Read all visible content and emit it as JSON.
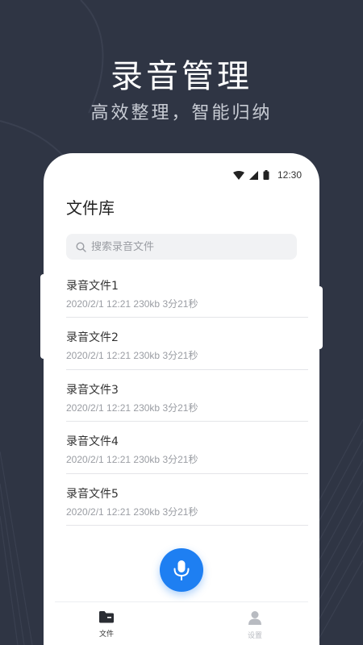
{
  "promo": {
    "title": "录音管理",
    "subtitle": "高效整理，智能归纳"
  },
  "status_bar": {
    "time": "12:30",
    "icons": [
      "wifi-icon",
      "cellular-signal-icon",
      "battery-icon"
    ]
  },
  "page": {
    "title": "文件库"
  },
  "search": {
    "placeholder": "搜索录音文件"
  },
  "files": [
    {
      "name": "录音文件1",
      "meta": "2020/2/1 12:21 230kb 3分21秒"
    },
    {
      "name": "录音文件2",
      "meta": "2020/2/1 12:21 230kb 3分21秒"
    },
    {
      "name": "录音文件3",
      "meta": "2020/2/1 12:21 230kb 3分21秒"
    },
    {
      "name": "录音文件4",
      "meta": "2020/2/1 12:21 230kb 3分21秒"
    },
    {
      "name": "录音文件5",
      "meta": "2020/2/1 12:21 230kb 3分21秒"
    }
  ],
  "record_button": {
    "icon": "microphone-icon"
  },
  "tabs": [
    {
      "label": "文件",
      "icon": "folder-icon",
      "active": true
    },
    {
      "label": "设置",
      "icon": "user-icon",
      "active": false
    }
  ],
  "colors": {
    "background": "#2f3544",
    "accent": "#1e7ff2",
    "card": "#ffffff",
    "muted_text": "#9a9da3"
  }
}
